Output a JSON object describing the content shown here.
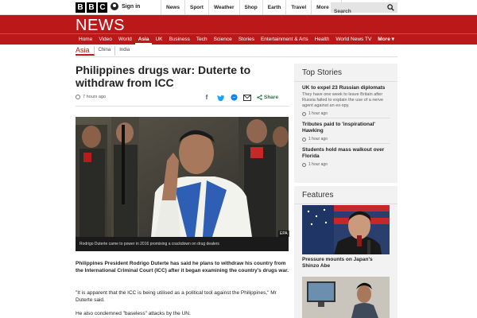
{
  "top": {
    "logo_letters": [
      "B",
      "B",
      "C"
    ],
    "signin_label": "Sign in",
    "nav": [
      "News",
      "Sport",
      "Weather",
      "Shop",
      "Earth",
      "Travel",
      "More"
    ],
    "search_placeholder": "Search"
  },
  "header": {
    "title": "NEWS",
    "nav": [
      "Home",
      "Video",
      "World",
      "Asia",
      "UK",
      "Business",
      "Tech",
      "Science",
      "Stories",
      "Entertainment & Arts",
      "Health",
      "World News TV",
      "More ▾"
    ],
    "active": "Asia"
  },
  "subnav": [
    "Asia",
    "China",
    "India"
  ],
  "article": {
    "headline": "Philippines drugs war: Duterte to withdraw from ICC",
    "timestamp": "7 hours ago",
    "share_label": "Share",
    "caption": "Rodrigo Duterte came to power in 2016 promising a crackdown on drug dealers",
    "photo_credit": "EPA",
    "lede": "Philippines President Rodrigo Duterte has said he plans to withdraw his country from the International Criminal Court (ICC) after it began examining the country's drugs war.",
    "p2": "\"It is apparent that the ICC is being utilised as a political tool against the Philippines,\" Mr Duterte said.",
    "p3": "He also condemned \"baseless\" attacks by the UN."
  },
  "sidebar": {
    "top_stories_title": "Top Stories",
    "stories": [
      {
        "headline": "UK to expel 23 Russian diplomats",
        "summary": "They have one week to leave Britain after Russia failed to explain the use of a nerve agent against an ex-spy.",
        "time": "1 hour ago"
      },
      {
        "headline": "Tributes paid to 'inspirational' Hawking",
        "summary": "",
        "time": "1 hour ago"
      },
      {
        "headline": "Students hold mass walkout over Florida",
        "summary": "",
        "time": "1 hour ago"
      }
    ],
    "features_title": "Features",
    "features": [
      {
        "caption": "Pressure mounts on Japan's Shinzo Abe"
      }
    ]
  },
  "colors": {
    "brand_red": "#bb1919",
    "share_blue": "#1e6fb8",
    "share_green": "#1b7a3a"
  }
}
